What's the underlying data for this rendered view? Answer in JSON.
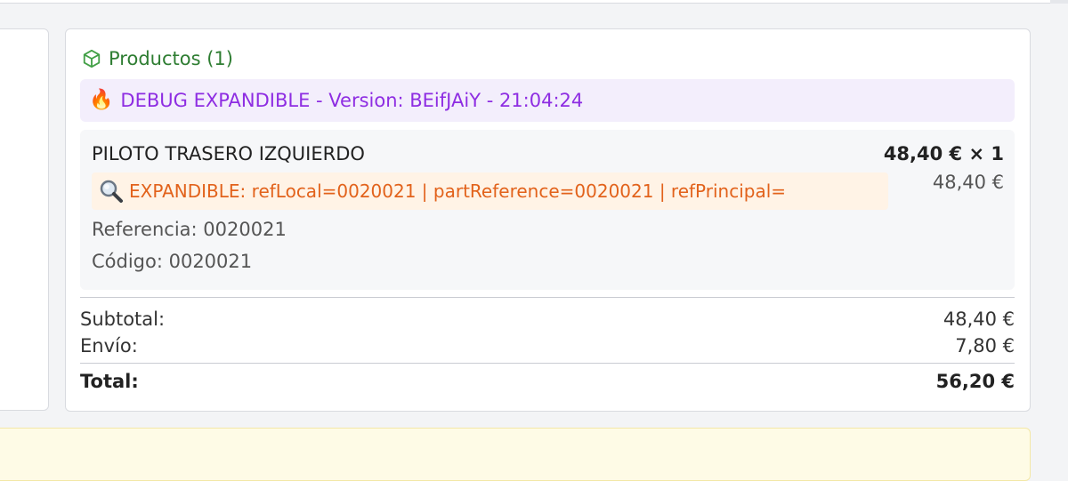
{
  "products": {
    "header_title": "Productos (1)",
    "header_icon": "package-box-icon",
    "debug_banner": {
      "icon": "fire-icon",
      "text": "DEBUG EXPANDIBLE - Version: BEifJAiY - 21:04:24"
    },
    "item": {
      "name": "PILOTO TRASERO IZQUIERDO",
      "price_qty": "48,40 € × 1",
      "price": "48,40 €",
      "expandible_icon": "magnifying-glass-icon",
      "expandible_text": "EXPANDIBLE: refLocal=0020021 | partReference=0020021 | refPrincipal=",
      "referencia": "Referencia: 0020021",
      "codigo": "Código: 0020021"
    },
    "summary": {
      "subtotal_label": "Subtotal:",
      "subtotal_value": "48,40 €",
      "envio_label": "Envío:",
      "envio_value": "7,80 €",
      "total_label": "Total:",
      "total_value": "56,20 €"
    }
  },
  "colors": {
    "header_green": "#2e7d32",
    "debug_purple": "#8e2de2",
    "debug_bg": "#f3eefc",
    "expandible_orange": "#e2621b",
    "expandible_bg": "#fff3e6"
  }
}
